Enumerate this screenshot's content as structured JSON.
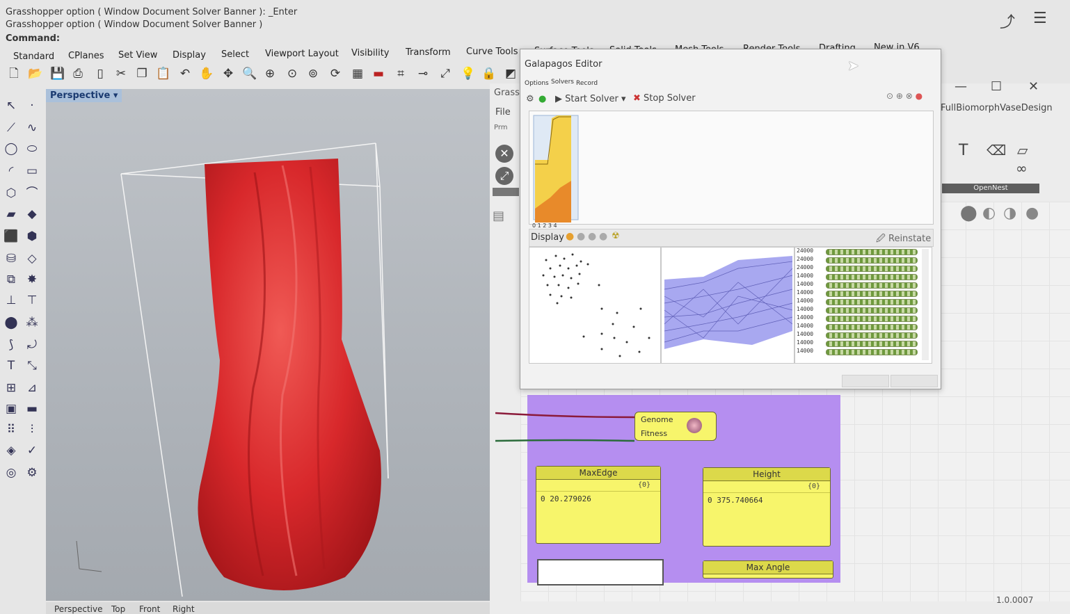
{
  "command_history": [
    "Grasshopper option ( Window  Document  Solver  Banner ): _Enter",
    "Grasshopper option ( Window  Document  Solver  Banner )"
  ],
  "command_prompt": "Command:",
  "toolbar_tabs": [
    "Standard",
    "CPlanes",
    "Set View",
    "Display",
    "Select",
    "Viewport Layout",
    "Visibility",
    "Transform",
    "Curve Tools",
    "Surface Tools",
    "Solid Tools",
    "Mesh Tools",
    "Render Tools",
    "Drafting",
    "New in V6"
  ],
  "viewport": {
    "label": "Perspective",
    "bottom_tabs": [
      "Perspective",
      "Top",
      "Front",
      "Right"
    ],
    "model_color": "#d8282b"
  },
  "grasshopper": {
    "title_fragment": "Grassh",
    "menu_file": "File",
    "tab_prm": "Prm",
    "document_title": "FullBiomorphVaseDesign",
    "opennest_label": "OpenNest",
    "version": "1.0.0007"
  },
  "galapagos": {
    "title": "Galapagos Editor",
    "tabs": [
      "Options",
      "Solvers",
      "Record"
    ],
    "start_solver": "Start Solver",
    "stop_solver": "Stop Solver",
    "x_ticks": "0  1  2  3  4",
    "display_label": "Display",
    "reinstate": "Reinstate",
    "fitness_values": [
      "24000",
      "24000",
      "24000",
      "14000",
      "14000",
      "14000",
      "14000",
      "14000",
      "14000",
      "14000",
      "14000",
      "14000",
      "14000"
    ]
  },
  "components": {
    "galapagos_genome": "Genome",
    "galapagos_fitness": "Fitness",
    "maxedge": {
      "name": "MaxEdge",
      "path": "{0}",
      "index": "0",
      "value": "20.279026"
    },
    "height": {
      "name": "Height",
      "path": "{0}",
      "index": "0",
      "value": "375.740664"
    },
    "maxangle": "Max Angle"
  },
  "top_right_icons": [
    "share-icon",
    "tune-icon"
  ]
}
